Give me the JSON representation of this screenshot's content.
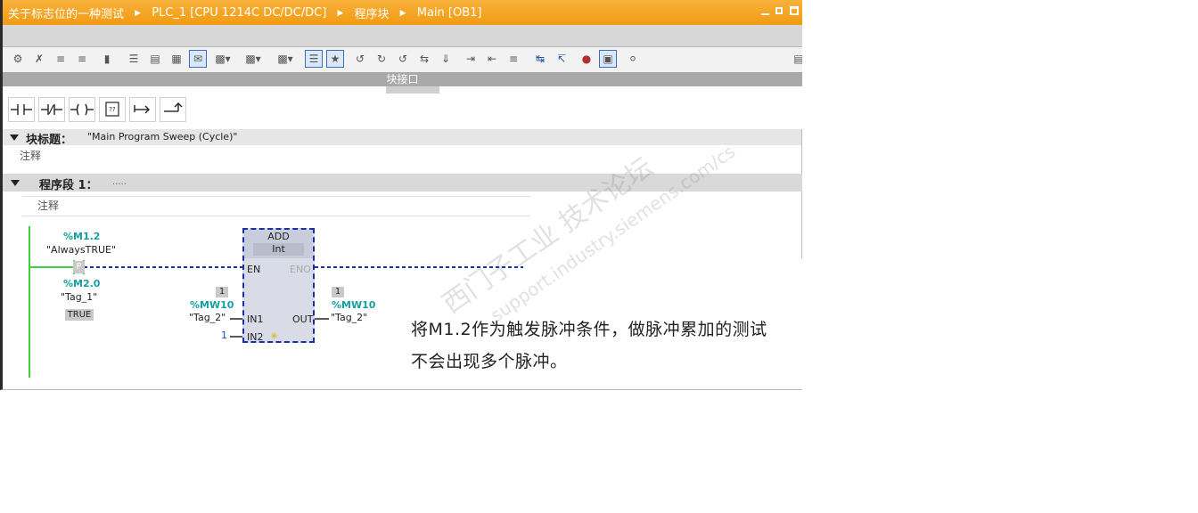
{
  "titlebar": {
    "crumbs": [
      "关于标志位的一种测试",
      "PLC_1 [CPU 1214C DC/DC/DC]",
      "程序块",
      "Main [OB1]"
    ],
    "bg": "#f5a623"
  },
  "interface_bar": {
    "label": "块接口"
  },
  "block": {
    "title_label": "块标题：",
    "title_value": "\"Main Program Sweep (Cycle)\"",
    "comment": "注释"
  },
  "network": {
    "label": "程序段 1：",
    "placeholder": ".....",
    "comment": "注释"
  },
  "ladder": {
    "contact_addr": "%M1.2",
    "contact_name": "\"AlwaysTRUE\"",
    "contact_type": "P",
    "edge_addr": "%M2.0",
    "edge_name": "\"Tag_1\"",
    "edge_value": "TRUE",
    "add": {
      "name": "ADD",
      "type": "Int",
      "en": "EN",
      "eno": "ENO",
      "in1": "IN1",
      "in2": "IN2",
      "out": "OUT",
      "in1_value": "1",
      "in1_addr": "%MW10",
      "in1_name": "\"Tag_2\"",
      "in2_value": "1",
      "out_value": "1",
      "out_addr": "%MW10",
      "out_name": "\"Tag_2\""
    }
  },
  "note": {
    "line1": "将M1.2作为触发脉冲条件，做脉冲累加的测试",
    "line2": "不会出现多个脉冲。"
  },
  "watermark": {
    "text1": "西门子工业  技术论坛",
    "text2": "support.industry.siemens.com/cs"
  }
}
